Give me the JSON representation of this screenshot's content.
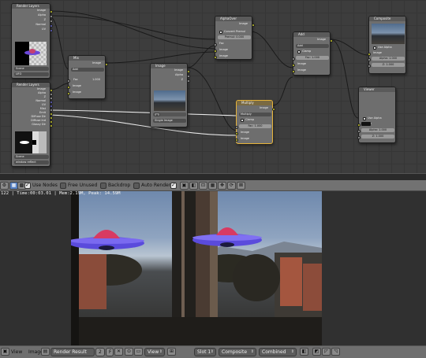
{
  "node_editor": {
    "nodes": {
      "render_layers": {
        "title": "Render Layers",
        "outputs": [
          "Image",
          "Alpha",
          "Z",
          "Normal",
          "UV"
        ],
        "scene": "Scene",
        "layer": "UFO"
      },
      "render_layers_2": {
        "title": "Render Layers",
        "outputs": [
          "Image",
          "Alpha",
          "Z",
          "Normal",
          "UV",
          "Mist",
          "Emit",
          "Diffuse Dir",
          "Diffuse Ind",
          "Glossy Dir"
        ],
        "scene": "Scene",
        "layer": "window reflect"
      },
      "mix": {
        "title": "Mix",
        "output": "Image",
        "mode": "Add",
        "fac_label": "Fac",
        "fac_value": "1.000",
        "inputs": [
          "Image",
          "Image"
        ]
      },
      "image": {
        "title": "Image",
        "outputs": [
          "Image",
          "Alpha",
          "Z"
        ],
        "type": "Single Image"
      },
      "alphaover": {
        "title": "AlphaOver",
        "output": "Image",
        "convert_label": "Convert Premul",
        "premul_label": "Premul",
        "premul_value": "0.000",
        "inputs": [
          "Fac",
          "Image",
          "Image"
        ]
      },
      "multiply": {
        "title": "Multiply",
        "output": "Image",
        "mode": "Multiply",
        "clamp_label": "Clamp",
        "fac_label": "Fac",
        "fac_value": "1.000",
        "inputs": [
          "Image",
          "Image"
        ]
      },
      "add": {
        "title": "Add",
        "output": "Image",
        "mode": "Add",
        "clamp_label": "Clamp",
        "fac_label": "Fac",
        "fac_value": "1.000",
        "inputs": [
          "Image",
          "Image"
        ]
      },
      "composite": {
        "title": "Composite",
        "use_alpha_label": "Use Alpha",
        "inputs": [
          "Image",
          "Alpha",
          "Z"
        ],
        "alpha_value": "1.000",
        "z_value": "1.000"
      },
      "viewer": {
        "title": "Viewer",
        "use_alpha_label": "Use Alpha",
        "inputs": [
          "Image",
          "Alpha",
          "Z"
        ],
        "alpha_value": "1.000",
        "z_value": "1.000"
      }
    }
  },
  "compositor_header": {
    "use_nodes": "Use Nodes",
    "free_unused": "Free Unused",
    "backdrop": "Backdrop",
    "auto_render": "Auto Render"
  },
  "viewer": {
    "status": "122 | Time:00:03.01 | Mem:2.19M, Peak: 14.59M"
  },
  "footer": {
    "view": "View",
    "image": "Image",
    "image_name": "Render Result",
    "users": "2",
    "fake_user": "F",
    "view2": "View",
    "slot": "Slot 1",
    "layer": "Composite",
    "pass": "Combined"
  }
}
